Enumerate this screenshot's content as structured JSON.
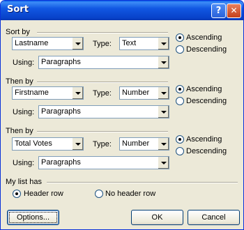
{
  "title": "Sort",
  "sort_by": {
    "label": "Sort by",
    "field": "Lastname",
    "type_label": "Type:",
    "type": "Text",
    "using_label": "Using:",
    "using": "Paragraphs",
    "order": "Ascending",
    "ascending_label": "Ascending",
    "descending_label": "Descending"
  },
  "then_by_1": {
    "label": "Then by",
    "field": "Firstname",
    "type_label": "Type:",
    "type": "Number",
    "using_label": "Using:",
    "using": "Paragraphs",
    "order": "Ascending",
    "ascending_label": "Ascending",
    "descending_label": "Descending"
  },
  "then_by_2": {
    "label": "Then by",
    "field": "Total Votes",
    "type_label": "Type:",
    "type": "Number",
    "using_label": "Using:",
    "using": "Paragraphs",
    "order": "Ascending",
    "ascending_label": "Ascending",
    "descending_label": "Descending"
  },
  "list_has": {
    "label": "My list has",
    "header_row_label": "Header row",
    "no_header_row_label": "No header row",
    "selected": "Header row"
  },
  "buttons": {
    "options": "Options...",
    "ok": "OK",
    "cancel": "Cancel"
  },
  "icons": {
    "help": "help-icon",
    "close": "close-icon"
  },
  "colors": {
    "title_bar": "#0842c9",
    "dialog_face": "#ece9d8",
    "close_button": "#c4401a"
  }
}
